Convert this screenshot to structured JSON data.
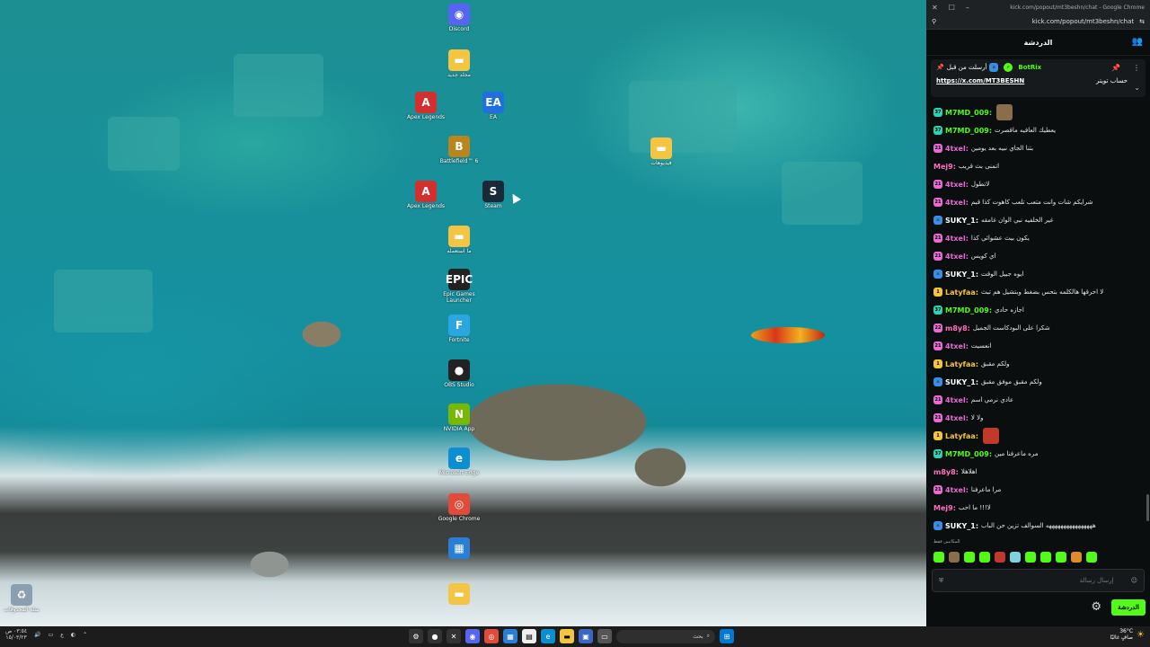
{
  "browser": {
    "title": "kick.com/popout/mt3beshn/chat - Google Chrome",
    "url": "kick.com/popout/mt3beshn/chat"
  },
  "chat": {
    "header": "الدردشة",
    "pinned": {
      "pinned_by_label": "أرسلت من قبل",
      "bot_name": "BotRix",
      "link_label": "حساب تويتر",
      "url": "https://x.com/MT3BESHN"
    },
    "messages": [
      {
        "user": "M7MD_009:",
        "text": "",
        "color": "#53fc18",
        "badge": "37",
        "badge_color": "#2bd4b0",
        "emote": true
      },
      {
        "user": "M7MD_009:",
        "text": "يعطيك العافيه ماقصرت",
        "color": "#53fc18",
        "badge": "37",
        "badge_color": "#2bd4b0"
      },
      {
        "user": "4txel:",
        "text": "بتنا الجاي نبيه بعد يومين",
        "color": "#e86ad3",
        "badge": "21",
        "badge_color": "#e86ad3"
      },
      {
        "user": "Mej9:",
        "text": "اتمنى بث قريب",
        "color": "#ff71bd",
        "badge": "",
        "badge_color": ""
      },
      {
        "user": "4txel:",
        "text": "لاتطول",
        "color": "#e86ad3",
        "badge": "21",
        "badge_color": "#e86ad3"
      },
      {
        "user": "4txel:",
        "text": "شرايكم شات وانت متعب تلعب كاهوت كذا قيم",
        "color": "#e86ad3",
        "badge": "21",
        "badge_color": "#e86ad3"
      },
      {
        "user": "SUKY_1:",
        "text": "غير الخلفيه نبي الوان غامقه",
        "color": "#ffffff",
        "badge": "⚔",
        "badge_color": "#3a8ee6"
      },
      {
        "user": "4txel:",
        "text": "يكون بيث عشوائي كذا",
        "color": "#e86ad3",
        "badge": "21",
        "badge_color": "#e86ad3"
      },
      {
        "user": "4txel:",
        "text": "اي كويس",
        "color": "#e86ad3",
        "badge": "21",
        "badge_color": "#e86ad3"
      },
      {
        "user": "SUKY_1:",
        "text": "ايوه جبيل الوقت",
        "color": "#ffffff",
        "badge": "⚔",
        "badge_color": "#3a8ee6"
      },
      {
        "user": "Latyfaa:",
        "text": "لا احرقها هالكلمه بتحس بضغط وبتشيل هم تبث",
        "color": "#f5c542",
        "badge": "1",
        "badge_color": "#f5c542"
      },
      {
        "user": "M7MD_009:",
        "text": "اجازه حادي",
        "color": "#53fc18",
        "badge": "37",
        "badge_color": "#2bd4b0"
      },
      {
        "user": "m8y8:",
        "text": "شكرا على البودكاست الجميل",
        "color": "#ff71bd",
        "badge": "22",
        "badge_color": "#e86ad3"
      },
      {
        "user": "4txel:",
        "text": "انعسيت",
        "color": "#e86ad3",
        "badge": "21",
        "badge_color": "#e86ad3"
      },
      {
        "user": "Latyfaa:",
        "text": "ولكم مقبق",
        "color": "#f5c542",
        "badge": "1",
        "badge_color": "#f5c542"
      },
      {
        "user": "SUKY_1:",
        "text": "ولكم مقبق موفق مقبق",
        "color": "#ffffff",
        "badge": "⚔",
        "badge_color": "#3a8ee6"
      },
      {
        "user": "4txel:",
        "text": "عادي نرمي اسم",
        "color": "#e86ad3",
        "badge": "21",
        "badge_color": "#e86ad3"
      },
      {
        "user": "4txel:",
        "text": "ولا لا",
        "color": "#e86ad3",
        "badge": "21",
        "badge_color": "#e86ad3"
      },
      {
        "user": "Latyfaa:",
        "text": "",
        "color": "#f5c542",
        "badge": "1",
        "badge_color": "#f5c542",
        "emote": true
      },
      {
        "user": "M7MD_009:",
        "text": "مره ماعرفنا مين",
        "color": "#53fc18",
        "badge": "37",
        "badge_color": "#2bd4b0"
      },
      {
        "user": "m8y8:",
        "text": "اهلاهلا",
        "color": "#ff71bd",
        "badge": "",
        "badge_color": ""
      },
      {
        "user": "4txel:",
        "text": "مرا ماعرفنا",
        "color": "#e86ad3",
        "badge": "21",
        "badge_color": "#e86ad3"
      },
      {
        "user": "Mej9:",
        "text": "لا!!! ما احب",
        "color": "#ff71bd",
        "badge": "",
        "badge_color": ""
      },
      {
        "user": "SUKY_1:",
        "text": "ههههههههههههههههه السوالف تزين حن الباب",
        "color": "#ffffff",
        "badge": "⚔",
        "badge_color": "#3a8ee6"
      }
    ],
    "recent_emotes_label": "المكاتبين فقط",
    "input_placeholder": "إرسال رسالة",
    "chat_button": "الدردشة"
  },
  "desktop": {
    "icons": [
      {
        "label": "Discord",
        "color": "#5865f2",
        "glyph": "◉"
      },
      {
        "label": "مجلد جديد",
        "color": "#f4c542",
        "glyph": "▬"
      },
      {
        "label": "Apex Legends",
        "color": "#d32f2f",
        "glyph": "A"
      },
      {
        "label": "EA",
        "color": "#1f6fe0",
        "glyph": "EA"
      },
      {
        "label": "Battlefield™ 6",
        "color": "#b8861c",
        "glyph": "B"
      },
      {
        "label": "فيديوهات",
        "color": "#f4c542",
        "glyph": "▬"
      },
      {
        "label": "Apex Legends",
        "color": "#d32f2f",
        "glyph": "A"
      },
      {
        "label": "Steam",
        "color": "#1b2838",
        "glyph": "S"
      },
      {
        "label": "ما استعمله",
        "color": "#f4c542",
        "glyph": "▬"
      },
      {
        "label": "Epic Games Launcher",
        "color": "#222",
        "glyph": "EPIC"
      },
      {
        "label": "Fortnite",
        "color": "#2aa7e0",
        "glyph": "F"
      },
      {
        "label": "OBS Studio",
        "color": "#222",
        "glyph": "●"
      },
      {
        "label": "NVIDIA App",
        "color": "#76b900",
        "glyph": "N"
      },
      {
        "label": "Microsoft Edge",
        "color": "#0c8fd0",
        "glyph": "e"
      },
      {
        "label": "Google Chrome",
        "color": "#e04b3a",
        "glyph": "◎"
      },
      {
        "label": "",
        "color": "#2a7fd4",
        "glyph": "▦"
      },
      {
        "label": "",
        "color": "#f4c542",
        "glyph": "▬"
      },
      {
        "label": "سلة المحذوفات",
        "color": "#8aa0b0",
        "glyph": "♻"
      }
    ]
  },
  "taskbar": {
    "clock_time": "٠٣:٥٤ ص",
    "clock_date": "١٥/٠٣/٢٣",
    "lang": "ع",
    "search_placeholder": "بحث",
    "weather_temp": "36°C",
    "weather_desc": "صافٍ غالبًا"
  }
}
